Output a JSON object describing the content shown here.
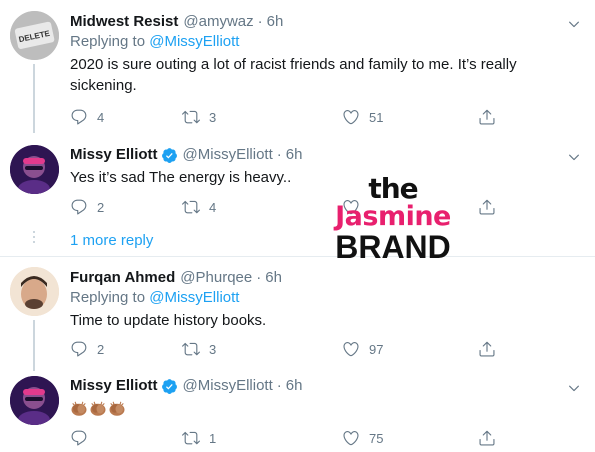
{
  "tweets": [
    {
      "name": "Midwest Resist",
      "handle": "@amywaz",
      "time": "6h",
      "verified": false,
      "reply_prefix": "Replying to",
      "reply_to": "@MissyElliott",
      "text": "2020 is sure outing a lot of racist friends and family to me. It’s really sickening.",
      "replies": "4",
      "retweets": "3",
      "likes": "51",
      "avatar_text": "DELETE"
    },
    {
      "name": "Missy Elliott",
      "handle": "@MissyElliott",
      "time": "6h",
      "verified": true,
      "text": "Yes it’s sad The energy is heavy..",
      "replies": "2",
      "retweets": "4",
      "likes": "",
      "more_replies": "1 more reply"
    },
    {
      "name": "Furqan Ahmed",
      "handle": "@Phurqee",
      "time": "6h",
      "verified": false,
      "reply_prefix": "Replying to",
      "reply_to": "@MissyElliott",
      "text": "Time to update history books.",
      "replies": "2",
      "retweets": "3",
      "likes": "97"
    },
    {
      "name": "Missy Elliott",
      "handle": "@MissyElliott",
      "time": "6h",
      "verified": true,
      "text": "",
      "emoji": [
        "clapping-hands",
        "clapping-hands",
        "clapping-hands"
      ],
      "replies": "",
      "retweets": "1",
      "likes": "75"
    }
  ],
  "watermark": {
    "line1": "the",
    "line2": "Jasmine",
    "line3": "BRAND"
  },
  "colors": {
    "accent": "#1da1f2",
    "muted": "#657786",
    "brand_pink": "#e8206e"
  },
  "icons": [
    "reply-icon",
    "retweet-icon",
    "like-icon",
    "share-icon",
    "chevron-down-icon",
    "verified-badge-icon"
  ]
}
